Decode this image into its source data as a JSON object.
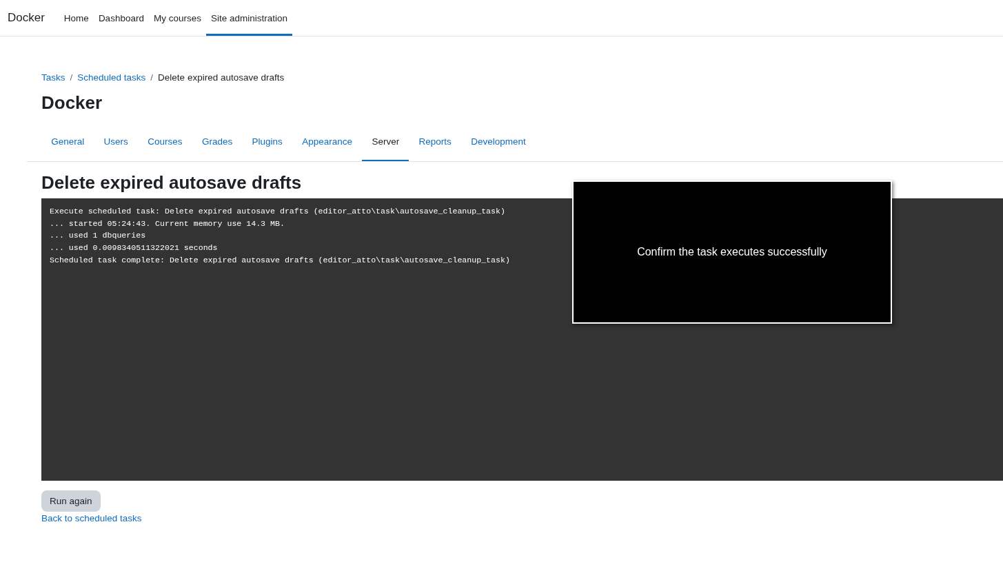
{
  "navbar": {
    "brand": "Docker",
    "items": [
      {
        "label": "Home",
        "selected": false
      },
      {
        "label": "Dashboard",
        "selected": false
      },
      {
        "label": "My courses",
        "selected": false
      },
      {
        "label": "Site administration",
        "selected": true
      }
    ]
  },
  "breadcrumb": [
    {
      "label": "Tasks",
      "link": true,
      "separator": "/"
    },
    {
      "label": "Scheduled tasks",
      "link": true,
      "separator": "/"
    },
    {
      "label": "Delete expired autosave drafts",
      "link": false
    }
  ],
  "page_title": "Docker",
  "tabs": [
    {
      "label": "General",
      "selected": false
    },
    {
      "label": "Users",
      "selected": false
    },
    {
      "label": "Courses",
      "selected": false
    },
    {
      "label": "Grades",
      "selected": false
    },
    {
      "label": "Plugins",
      "selected": false
    },
    {
      "label": "Appearance",
      "selected": false
    },
    {
      "label": "Server",
      "selected": true
    },
    {
      "label": "Reports",
      "selected": false
    },
    {
      "label": "Development",
      "selected": false
    }
  ],
  "heading": "Delete expired autosave drafts",
  "output_lines": [
    "Execute scheduled task: Delete expired autosave drafts (editor_atto\\task\\autosave_cleanup_task)",
    "... started 05:24:43. Current memory use 14.3 MB.",
    "... used 1 dbqueries",
    "... used 0.0098340511322021 seconds",
    "Scheduled task complete: Delete expired autosave drafts (editor_atto\\task\\autosave_cleanup_task)"
  ],
  "overlay": {
    "text": "Confirm the task executes successfully"
  },
  "run_again_button": "Run again",
  "back_link": "Back to scheduled tasks"
}
